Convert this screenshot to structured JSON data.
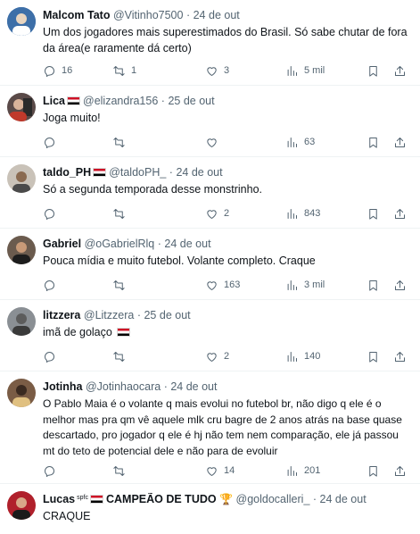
{
  "replies": [
    {
      "name": "Malcom Tato",
      "handle": "@Vitinho7500",
      "sep": "·",
      "date": "24 de out",
      "text": "Um dos jogadores mais superestimados do Brasil. Só sabe chutar de fora da área(e raramente dá certo)",
      "replies_count": "16",
      "retweets": "1",
      "likes": "3",
      "views": "5 mil",
      "avatar_color": "#3d6fa8"
    },
    {
      "name": "Lica",
      "handle": "@elizandra156",
      "sep": "·",
      "date": "25 de out",
      "text": "Joga muito!",
      "replies_count": "",
      "retweets": "",
      "likes": "",
      "views": "63",
      "avatar_color": "#5a4a48"
    },
    {
      "name": "taldo_PH",
      "handle": "@taldoPH_",
      "sep": "·",
      "date": "24 de out",
      "text": "Só a segunda temporada desse monstrinho.",
      "replies_count": "",
      "retweets": "",
      "likes": "2",
      "views": "843",
      "avatar_color": "#c9c2b8"
    },
    {
      "name": "Gabriel",
      "handle": "@oGabrielRlq",
      "sep": "·",
      "date": "24 de out",
      "text": "Pouca mídia e muito futebol. Volante completo. Craque",
      "replies_count": "",
      "retweets": "",
      "likes": "163",
      "views": "3 mil",
      "avatar_color": "#6b5b4e"
    },
    {
      "name": "litzzera",
      "handle": "@Litzzera",
      "sep": "·",
      "date": "25 de out",
      "text": "imã de golaço",
      "replies_count": "",
      "retweets": "",
      "likes": "2",
      "views": "140",
      "avatar_color": "#8a8f94"
    },
    {
      "name": "Jotinha",
      "handle": "@Jotinhaocara",
      "sep": "·",
      "date": "24 de out",
      "text": "O Pablo Maia é o volante q mais evolui no futebol br, não digo q ele é o melhor mas pra qm vê aquele mlk cru bagre de 2 anos atrás na base quase descartado, pro jogador q ele é hj não tem nem comparação, ele já passou mt do teto de potencial dele e não para de evoluir",
      "replies_count": "",
      "retweets": "",
      "likes": "14",
      "views": "201",
      "avatar_color": "#7a5c45"
    },
    {
      "name": "Lucas",
      "name_sup": "spfc",
      "name_suffix": "CAMPEÃO DE TUDO",
      "handle": "@goldocalleri_",
      "sep": "·",
      "date": "24 de out",
      "text": "CRAQUE",
      "avatar_color": "#b0202b"
    }
  ],
  "icons": {
    "reply": "reply-icon",
    "retweet": "retweet-icon",
    "like": "heart-icon",
    "views": "views-chart-icon",
    "bookmark": "bookmark-icon",
    "share": "share-icon",
    "flag": "spfc-flag-icon",
    "trophy": "trophy-icon"
  }
}
